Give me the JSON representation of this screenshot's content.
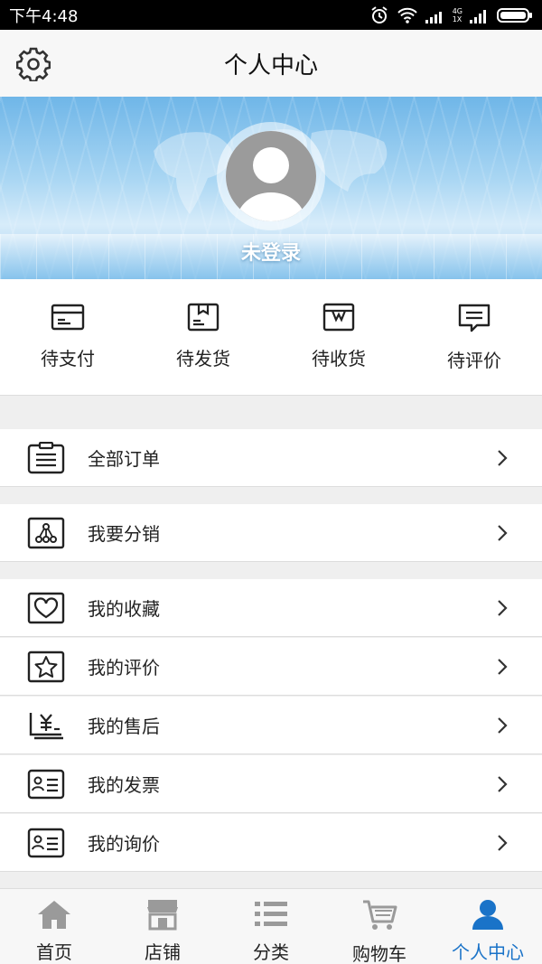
{
  "status_bar": {
    "time": "下午4:48",
    "net_top": "4G",
    "net_bottom": "1X"
  },
  "header": {
    "title": "个人中心",
    "settings_icon": "gear-icon"
  },
  "profile": {
    "login_text": "未登录",
    "avatar_icon": "user-avatar-icon"
  },
  "orders": [
    {
      "label": "待支付",
      "icon": "card-icon"
    },
    {
      "label": "待发货",
      "icon": "box-icon"
    },
    {
      "label": "待收货",
      "icon": "package-open-icon"
    },
    {
      "label": "待评价",
      "icon": "comment-icon"
    }
  ],
  "menu": [
    {
      "label": "全部订单",
      "icon": "clipboard-icon"
    },
    {
      "label": "我要分销",
      "icon": "network-icon"
    },
    {
      "label": "我的收藏",
      "icon": "heart-icon"
    },
    {
      "label": "我的评价",
      "icon": "star-icon"
    },
    {
      "label": "我的售后",
      "icon": "yen-receipt-icon"
    },
    {
      "label": "我的发票",
      "icon": "invoice-card-icon"
    },
    {
      "label": "我的询价",
      "icon": "inquiry-card-icon"
    }
  ],
  "bottom_nav": [
    {
      "label": "首页",
      "icon": "home-icon",
      "active": false
    },
    {
      "label": "店铺",
      "icon": "shop-icon",
      "active": false
    },
    {
      "label": "分类",
      "icon": "list-icon",
      "active": false
    },
    {
      "label": "购物车",
      "icon": "cart-icon",
      "active": false
    },
    {
      "label": "个人中心",
      "icon": "user-icon",
      "active": true
    }
  ],
  "colors": {
    "accent": "#1a73c8",
    "inactive_icon": "#9a9a9a"
  }
}
